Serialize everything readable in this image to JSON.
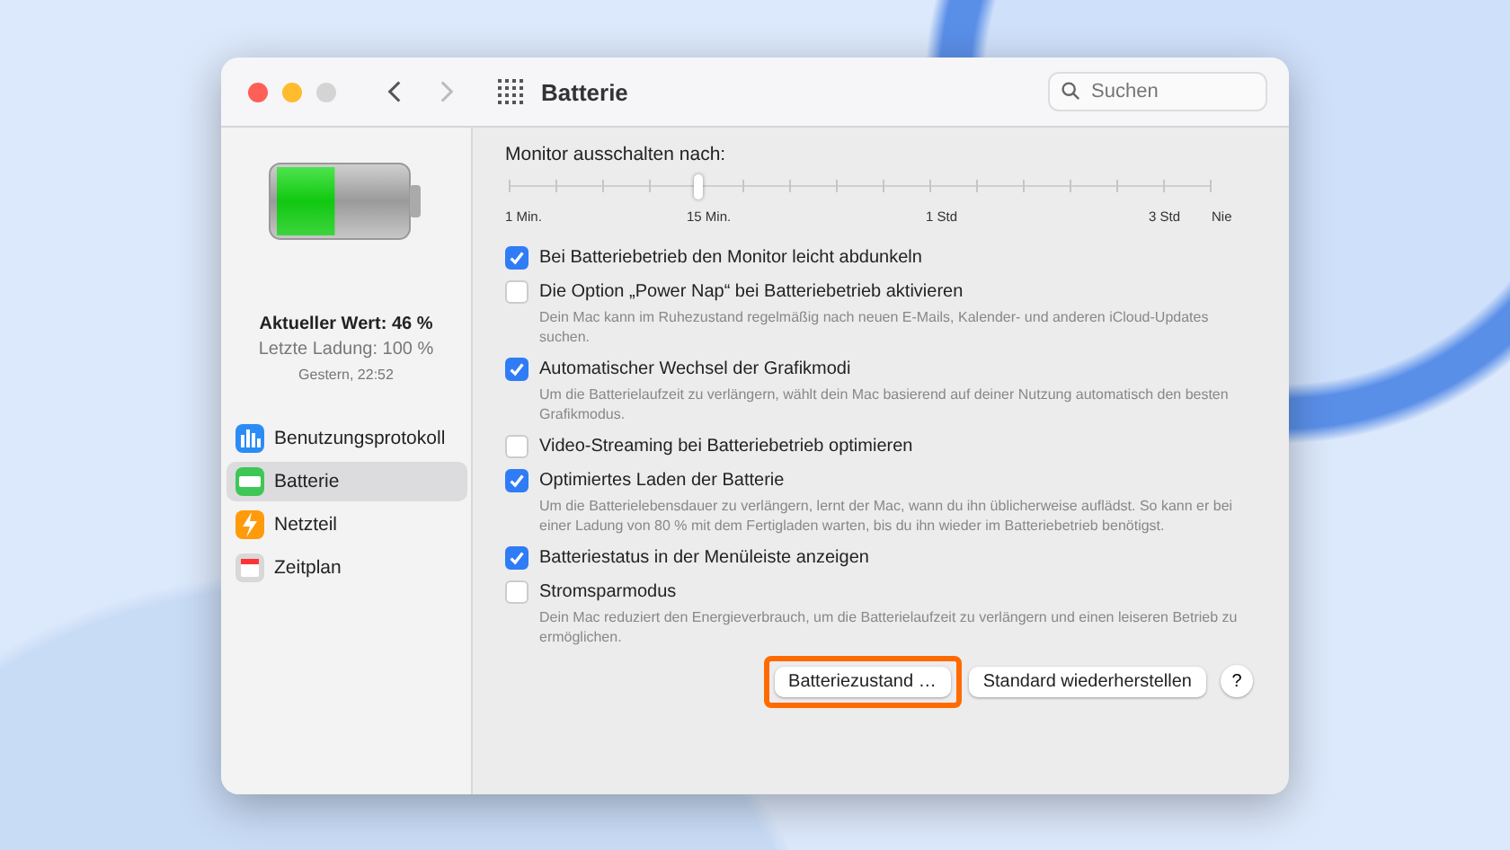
{
  "window": {
    "title": "Batterie",
    "search": {
      "placeholder": "Suchen"
    }
  },
  "battery": {
    "level": 0.46,
    "current": "Aktueller Wert: 46 %",
    "last_charge": "Letzte Ladung: 100 %",
    "time": "Gestern, 22:52"
  },
  "sidebar": {
    "items": [
      {
        "label": "Benutzungsprotokoll",
        "kind": "chart",
        "selected": false
      },
      {
        "label": "Batterie",
        "kind": "battery",
        "selected": true
      },
      {
        "label": "Netzteil",
        "kind": "bolt",
        "selected": false
      },
      {
        "label": "Zeitplan",
        "kind": "calendar",
        "selected": false
      }
    ]
  },
  "slider": {
    "label": "Monitor ausschalten nach:",
    "level": 0.27,
    "tick_labels": [
      "1 Min.",
      "15 Min.",
      "1 Std",
      "3 Std",
      "Nie"
    ]
  },
  "options": [
    {
      "label": "Bei Batteriebetrieb den Monitor leicht abdunkeln",
      "checked": true
    },
    {
      "label": "Die Option „Power Nap“ bei Batteriebetrieb aktivieren",
      "checked": false,
      "description": "Dein Mac kann im Ruhezustand regelmäßig nach neuen E-Mails, Kalender- und anderen iCloud-Updates suchen."
    },
    {
      "label": "Automatischer Wechsel der Grafikmodi",
      "checked": true,
      "description": "Um die Batterielaufzeit zu verlängern, wählt dein Mac basierend auf deiner Nutzung automatisch den besten Grafikmodus."
    },
    {
      "label": "Video-Streaming bei Batteriebetrieb optimieren",
      "checked": false
    },
    {
      "label": "Optimiertes Laden der Batterie",
      "checked": true,
      "description": "Um die Batterielebensdauer zu verlängern, lernt der Mac, wann du ihn üblicherweise auflädst. So kann er bei einer Ladung von 80 % mit dem Fertigladen warten, bis du ihn wieder im Batteriebetrieb benötigst."
    },
    {
      "label": "Batteriestatus in der Menüleiste anzeigen",
      "checked": true
    },
    {
      "label": "Stromsparmodus",
      "checked": false,
      "description": "Dein Mac reduziert den Energieverbrauch, um die Batterielaufzeit zu verlängern und einen leiseren Betrieb zu ermöglichen."
    }
  ],
  "buttons": [
    {
      "label": "Batteriezustand …",
      "highlighted": true
    },
    {
      "label": "Standard wiederherstellen",
      "highlighted": false
    }
  ],
  "help": "?"
}
